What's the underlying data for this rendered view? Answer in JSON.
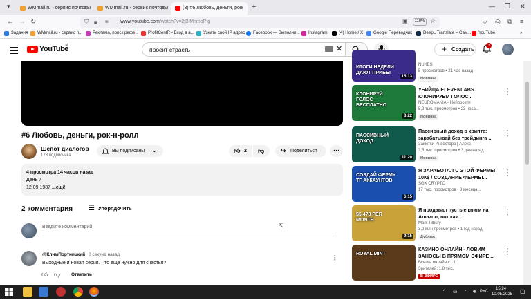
{
  "browser": {
    "tabs": [
      {
        "label": "WMmail.ru - сервис почтовы",
        "active": false
      },
      {
        "label": "WMmail.ru - сервис почтовы",
        "active": false
      },
      {
        "label": "(3) #6 Любовь, деньги, рок",
        "active": true
      }
    ],
    "url_host": "www.youtube.com",
    "url_path": "/watch?v=2jBlMnmbPfg",
    "zoom": "110%",
    "bookmarks": [
      "Задания",
      "WMmail.ru - сервис п...",
      "Реклама, поиск рефе...",
      "ProfitCentR - Вход в а...",
      "Узнать свой IP адрес",
      "Facebook — Выполни...",
      "Instagram",
      "(4) Home / X",
      "Google Переводчик",
      "DeepL Translate – Сам...",
      "YouTube"
    ]
  },
  "youtube": {
    "logo": "YouTube",
    "region": "UA",
    "search_value": "проект страсть",
    "create_label": "Создать",
    "notifications_count": "3"
  },
  "video": {
    "title": "#6 Любовь, деньги, рок-н-ролл",
    "channel": "Шепот диалогов",
    "subscribers": "173 подписчика",
    "subscribed_label": "Вы подписаны",
    "likes": "2",
    "share_label": "Поделиться",
    "views_line": "4 просмотра  14 часов назад",
    "desc_line1": "День 7",
    "desc_line2": "12.09.1987",
    "more_label": "...ещё"
  },
  "comments": {
    "count_label": "2 комментария",
    "sort_label": "Упорядочить",
    "add_placeholder": "Введите комментарий",
    "items": [
      {
        "author": "@КлимПортницкий",
        "time": "0 секунд назад",
        "text": "Выходные и новая серия. Что еще нужно для счастья?",
        "reply_label": "Ответить"
      }
    ]
  },
  "sidebar": [
    {
      "title": "",
      "channel": "NUKES",
      "meta": "5 просмотров  •  21 час назад",
      "badge": "Новинка",
      "thumb_text": "ИТОГИ НЕДЕЛИ ДАЮТ ПРИБЫ",
      "duration": "15:13",
      "color": "#3a2a8a"
    },
    {
      "title": "УБИЙЦА ELEVENLABS. КЛОНИРУЕМ ГОЛОС...",
      "channel": "NEUROMANIA - Нейросети",
      "meta": "5,2 тыс. просмотров  •  23 часа...",
      "badge": "Новинка",
      "thumb_text": "КЛОНИРУЙ ГОЛОС БЕСПЛАТНО",
      "duration": "8:22",
      "color": "#1e7a3a"
    },
    {
      "title": "Пассивный доход в крипте: зарабатывай без трейдинга ...",
      "channel": "Заметки Инвестора | Алекс",
      "meta": "3,5 тыс. просмотров  •  3 дня назад",
      "badge": "Новинка",
      "thumb_text": "ПАССИВНЫЙ ДОХОД",
      "duration": "11:20",
      "color": "#0f5a4a"
    },
    {
      "title": "Я ЗАРАБОТАЛ С ЭТОЙ ФЕРМЫ 10К$ / СОЗДАНИЕ ФЕРМЫ...",
      "channel": "SGX CRYPTO",
      "meta": "17 тыс. просмотров  •  3 месяца...",
      "badge": "",
      "thumb_text": "СОЗДАЙ ФЕРМУ ТГ АККАУНТОВ",
      "duration": "6:15",
      "color": "#1a4fb0"
    },
    {
      "title": "Я продавал пустые книги на Amazon, вот как...",
      "channel": "Mark Tilbury",
      "meta": "3,2 млн просмотров  •  1 год назад",
      "badge": "Дубляж",
      "thumb_text": "$5,478 PER MONTH",
      "duration": "9:15",
      "color": "#c9a23a"
    },
    {
      "title": "КАЗИНО ОНЛАЙН - ЛОВИМ ЗАНОСЫ В ПРЯМОМ ЭФИРЕ ...",
      "channel": "Всегда онлайн v1.1",
      "meta": "Зрителей: 1,8 тыс.",
      "badge": "В ЭФИРЕ",
      "thumb_text": "ROYAL MINT",
      "duration": "",
      "color": "#5a3a1a"
    }
  ],
  "taskbar": {
    "lang": "РУС",
    "time": "15:24",
    "date": "10.05.2025"
  }
}
